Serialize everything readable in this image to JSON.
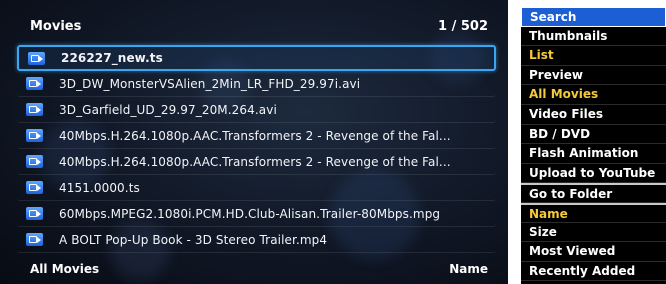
{
  "header": {
    "title": "Movies",
    "count": "1 / 502"
  },
  "files": [
    {
      "name": "226227_new.ts",
      "selected": true
    },
    {
      "name": "3D_DW_MonsterVSAlien_2Min_LR_FHD_29.97i.avi",
      "selected": false
    },
    {
      "name": "3D_Garfield_UD_29.97_20M.264.avi",
      "selected": false
    },
    {
      "name": "40Mbps.H.264.1080p.AAC.Transformers 2 - Revenge of the Fal...",
      "selected": false
    },
    {
      "name": "40Mbps.H.264.1080p.AAC.Transformers 2 - Revenge of the Fal...",
      "selected": false
    },
    {
      "name": "4151.0000.ts",
      "selected": false
    },
    {
      "name": "60Mbps.MPEG2.1080i.PCM.HD.Club-Alisan.Trailer-80Mbps.mpg",
      "selected": false
    },
    {
      "name": "A BOLT Pop-Up Book - 3D Stereo Trailer.mp4",
      "selected": false
    }
  ],
  "footer": {
    "filter": "All Movies",
    "sort": "Name"
  },
  "menu": [
    {
      "label": "Search",
      "state": "focused"
    },
    {
      "label": "Thumbnails",
      "state": "normal"
    },
    {
      "label": "List",
      "state": "active"
    },
    {
      "label": "Preview",
      "state": "normal"
    },
    {
      "label": "All Movies",
      "state": "active"
    },
    {
      "label": "Video Files",
      "state": "normal"
    },
    {
      "label": "BD / DVD",
      "state": "normal"
    },
    {
      "label": "Flash Animation",
      "state": "normal"
    },
    {
      "label": "Upload to YouTube",
      "state": "normal"
    },
    {
      "label": "Go to Folder",
      "state": "normal",
      "separator": true
    },
    {
      "label": "Name",
      "state": "active",
      "separator": true
    },
    {
      "label": "Size",
      "state": "normal"
    },
    {
      "label": "Most Viewed",
      "state": "normal"
    },
    {
      "label": "Recently Added",
      "state": "normal"
    }
  ],
  "colors": {
    "focus": "#1c5fd4",
    "selection_border": "#3aa6f0",
    "highlight": "#f6c93b"
  }
}
